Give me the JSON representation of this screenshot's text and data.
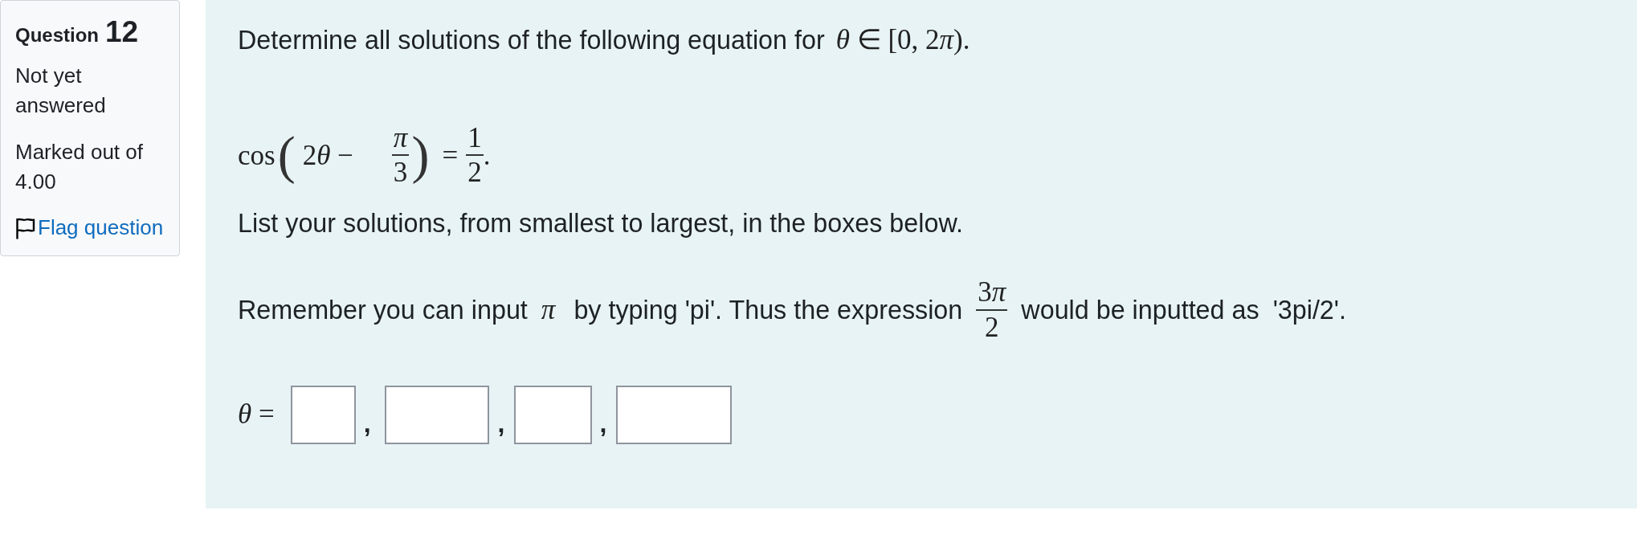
{
  "info": {
    "question_label": "Question",
    "question_number": "12",
    "status": "Not yet answered",
    "grade": "Marked out of 4.00",
    "flag": {
      "label": "Flag question",
      "flagged": false
    }
  },
  "question": {
    "intro": {
      "text": "Determine all solutions of the following equation for",
      "math": [
        {
          "text": "θ",
          "italic": true
        },
        {
          "text": " ∈ [0, 2",
          "italic": false
        },
        {
          "text": "π",
          "italic": true
        },
        {
          "text": ").",
          "italic": false
        }
      ]
    },
    "equation": {
      "function": "cos",
      "open": "(",
      "term": [
        {
          "text": "2",
          "italic": false
        },
        {
          "text": "θ",
          "italic": true
        },
        {
          "text": " −",
          "italic": false
        }
      ],
      "fraction": {
        "numerator": [
          {
            "text": "π",
            "italic": true
          }
        ],
        "denominator": [
          {
            "text": "3",
            "italic": false
          }
        ]
      },
      "close": ")",
      "relation": "=",
      "rhs": {
        "numerator": [
          {
            "text": "1",
            "italic": false
          }
        ],
        "denominator": [
          {
            "text": "2",
            "italic": false
          }
        ]
      },
      "end": "."
    },
    "instruction": "List your solutions, from smallest to largest, in the boxes below.",
    "hint": [
      {
        "kind": "text",
        "text": "Remember you can input"
      },
      {
        "kind": "math",
        "parts": [
          {
            "text": "π",
            "italic": true
          }
        ]
      },
      {
        "kind": "text",
        "text": "by typing 'pi'. Thus the expression"
      },
      {
        "kind": "fraction",
        "numerator": [
          {
            "text": "3",
            "italic": false
          },
          {
            "text": "π",
            "italic": true
          }
        ],
        "denominator": [
          {
            "text": "2",
            "italic": false
          }
        ]
      },
      {
        "kind": "text",
        "text": "would be inputted as"
      },
      {
        "kind": "text",
        "text": "'3pi/2'."
      }
    ],
    "answer": {
      "label": [
        {
          "text": "θ",
          "italic": true
        },
        {
          "text": " =",
          "italic": false
        }
      ],
      "items": [
        {
          "kind": "field"
        },
        {
          "kind": "separator",
          "text": ","
        },
        {
          "kind": "field"
        },
        {
          "kind": "separator",
          "text": ","
        },
        {
          "kind": "field"
        },
        {
          "kind": "separator",
          "text": ","
        },
        {
          "kind": "field"
        }
      ]
    }
  }
}
